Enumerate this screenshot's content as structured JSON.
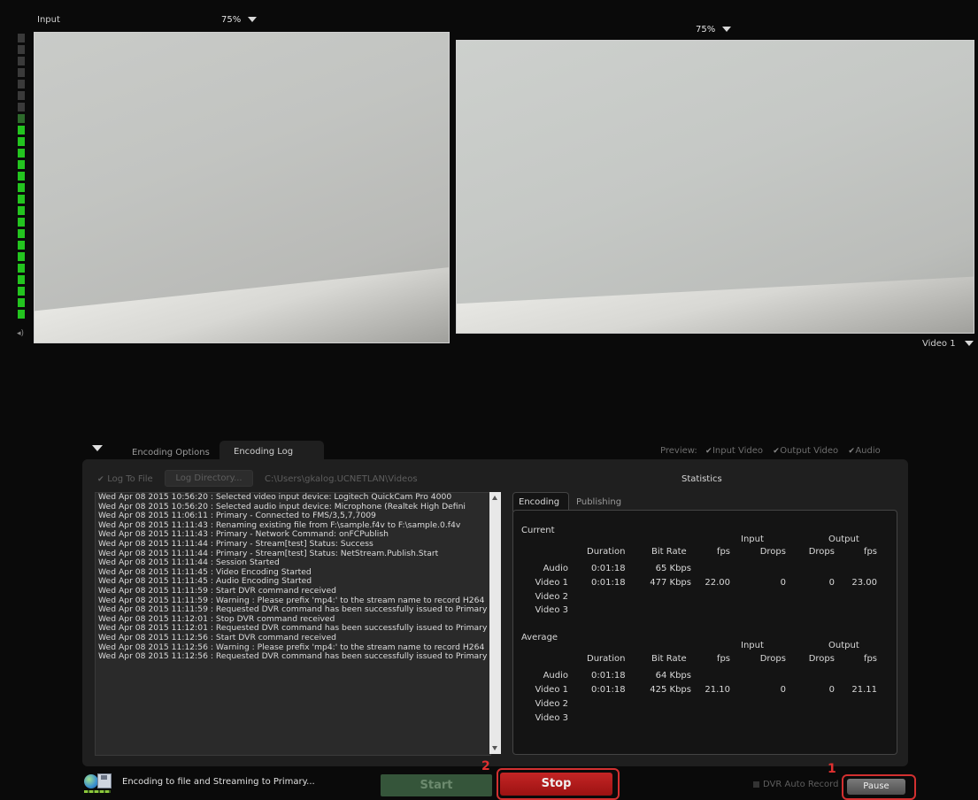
{
  "input_view": {
    "label": "Input",
    "zoom": "75%"
  },
  "output_view": {
    "zoom": "75%",
    "source_select": "Video 1"
  },
  "panel_tabs": {
    "encoding_options": "Encoding Options",
    "encoding_log": "Encoding Log"
  },
  "preview": {
    "label": "Preview:",
    "input_video": "Input Video",
    "output_video": "Output Video",
    "audio": "Audio"
  },
  "log_toolbar": {
    "log_to_file": "Log To File",
    "log_directory": "Log Directory...",
    "path": "C:\\Users\\gkalog.UCNETLAN\\Videos"
  },
  "log_lines": [
    "Wed Apr 08 2015 10:56:20 : Selected video input device: Logitech QuickCam Pro 4000",
    "Wed Apr 08 2015 10:56:20 : Selected audio input device: Microphone (Realtek High Defini",
    "Wed Apr 08 2015 11:06:11 : Primary - Connected to FMS/3,5,7,7009",
    "Wed Apr 08 2015 11:11:43 : Renaming existing file from F:\\sample.f4v to F:\\sample.0.f4v",
    "Wed Apr 08 2015 11:11:43 : Primary - Network Command: onFCPublish",
    "Wed Apr 08 2015 11:11:44 : Primary - Stream[test] Status: Success",
    "Wed Apr 08 2015 11:11:44 : Primary - Stream[test] Status: NetStream.Publish.Start",
    "Wed Apr 08 2015 11:11:44 : Session Started",
    "Wed Apr 08 2015 11:11:45 : Video Encoding Started",
    "Wed Apr 08 2015 11:11:45 : Audio Encoding Started",
    "Wed Apr 08 2015 11:11:59 : Start DVR command received",
    "Wed Apr 08 2015 11:11:59 : Warning : Please prefix 'mp4:' to the stream name to record H264",
    "Wed Apr 08 2015 11:11:59 : Requested DVR command has been successfully issued to Primary",
    "Wed Apr 08 2015 11:12:01 : Stop DVR command received",
    "Wed Apr 08 2015 11:12:01 : Requested DVR command has been successfully issued to Primary",
    "Wed Apr 08 2015 11:12:56 : Start DVR command received",
    "Wed Apr 08 2015 11:12:56 : Warning : Please prefix 'mp4:' to the stream name to record H264",
    "Wed Apr 08 2015 11:12:56 : Requested DVR command has been successfully issued to Primary"
  ],
  "stats": {
    "title": "Statistics",
    "tabs": {
      "encoding": "Encoding",
      "publishing": "Publishing"
    },
    "headers": {
      "input": "Input",
      "output": "Output",
      "duration": "Duration",
      "bit_rate": "Bit Rate",
      "fps": "fps",
      "drops": "Drops"
    },
    "current": {
      "label": "Current",
      "audio": {
        "name": "Audio",
        "duration": "0:01:18",
        "bitrate": "65 Kbps"
      },
      "video1": {
        "name": "Video 1",
        "duration": "0:01:18",
        "bitrate": "477 Kbps",
        "in_fps": "22.00",
        "in_drops": "0",
        "out_drops": "0",
        "out_fps": "23.00"
      },
      "video2": "Video 2",
      "video3": "Video 3"
    },
    "average": {
      "label": "Average",
      "audio": {
        "name": "Audio",
        "duration": "0:01:18",
        "bitrate": "64 Kbps"
      },
      "video1": {
        "name": "Video 1",
        "duration": "0:01:18",
        "bitrate": "425 Kbps",
        "in_fps": "21.10",
        "in_drops": "0",
        "out_drops": "0",
        "out_fps": "21.11"
      },
      "video2": "Video 2",
      "video3": "Video 3"
    }
  },
  "footer": {
    "status": "Encoding to file and Streaming to Primary...",
    "start": "Start",
    "stop": "Stop",
    "dvr_auto_record": "DVR Auto Record",
    "pause": "Pause",
    "marker_stop": "2",
    "marker_pause": "1"
  },
  "colors": {
    "highlight": "#d23030",
    "stop_button": "#b01818",
    "start_button": "#3e6a3e",
    "meter_green": "#23c41f"
  }
}
